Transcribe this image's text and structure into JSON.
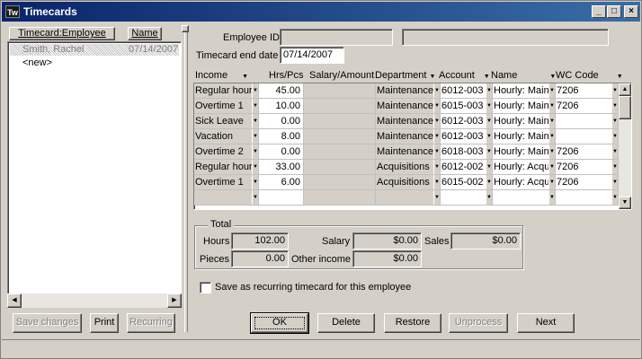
{
  "window": {
    "title": "Timecards",
    "icon_text": "Tw"
  },
  "left_panel": {
    "columns": [
      "Timecard:Employee",
      "Name"
    ],
    "items": [
      {
        "employee": "Smith, Rachel",
        "name": "07/14/2007",
        "selected": true
      },
      {
        "employee": "<new>",
        "name": "",
        "selected": false
      }
    ]
  },
  "left_buttons": {
    "save": "Save changes",
    "print": "Print",
    "recurring": "Recurring"
  },
  "header_fields": {
    "employee_id_label": "Employee ID",
    "employee_id_value": "",
    "employee_name_value": "",
    "end_date_label": "Timecard end date",
    "end_date_value": "07/14/2007"
  },
  "grid": {
    "columns": [
      "Income",
      "Hrs/Pcs",
      "Salary/Amount",
      "Department",
      "Account",
      "Name",
      "WC Code"
    ],
    "rows": [
      {
        "income": "Regular hour",
        "hrs": "45.00",
        "salary": "",
        "dept": "Maintenance",
        "account": "6012-003",
        "name": "Hourly: Maint",
        "wc": "7206"
      },
      {
        "income": "Overtime 1",
        "hrs": "10.00",
        "salary": "",
        "dept": "Maintenance",
        "account": "6015-003",
        "name": "Hourly: Maint",
        "wc": "7206"
      },
      {
        "income": "Sick Leave",
        "hrs": "0.00",
        "salary": "",
        "dept": "Maintenance",
        "account": "6012-003",
        "name": "Hourly: Maint",
        "wc": ""
      },
      {
        "income": "Vacation",
        "hrs": "8.00",
        "salary": "",
        "dept": "Maintenance",
        "account": "6012-003",
        "name": "Hourly: Maint",
        "wc": ""
      },
      {
        "income": "Overtime 2",
        "hrs": "0.00",
        "salary": "",
        "dept": "Maintenance",
        "account": "6018-003",
        "name": "Hourly: Maint",
        "wc": "7206"
      },
      {
        "income": "Regular hour",
        "hrs": "33.00",
        "salary": "",
        "dept": "Acquisitions",
        "account": "6012-002",
        "name": "Hourly: Acqu",
        "wc": "7206"
      },
      {
        "income": "Overtime 1",
        "hrs": "6.00",
        "salary": "",
        "dept": "Acquisitions",
        "account": "6015-002",
        "name": "Hourly: Acqu",
        "wc": "7206"
      },
      {
        "income": "",
        "hrs": "",
        "salary": "",
        "dept": "",
        "account": "",
        "name": "",
        "wc": ""
      }
    ]
  },
  "total": {
    "group_label": "Total",
    "hours_label": "Hours",
    "hours_value": "102.00",
    "pieces_label": "Pieces",
    "pieces_value": "0.00",
    "salary_label": "Salary",
    "salary_value": "$0.00",
    "other_income_label": "Other income",
    "other_income_value": "$0.00",
    "sales_label": "Sales",
    "sales_value": "$0.00"
  },
  "recurring_checkbox": {
    "label": "Save as recurring timecard for this employee",
    "checked": false
  },
  "bottom_buttons": {
    "ok": "OK",
    "delete": "Delete",
    "restore": "Restore",
    "unprocess": "Unprocess",
    "next": "Next"
  }
}
